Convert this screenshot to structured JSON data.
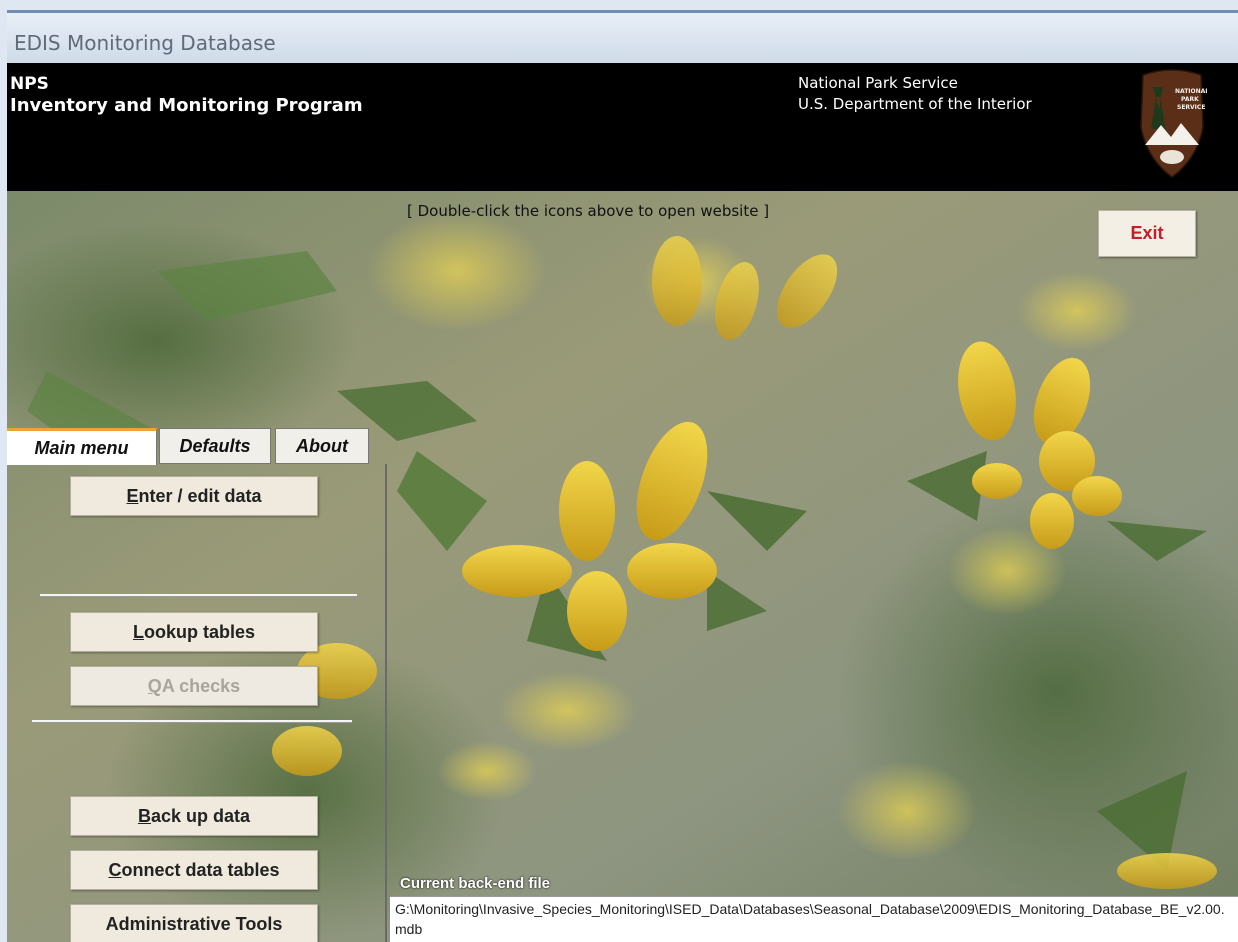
{
  "window": {
    "title": "EDIS Monitoring Database"
  },
  "header": {
    "program_short": "NPS",
    "program_name": "Inventory and Monitoring Program",
    "agency": "National Park Service",
    "department": "U.S. Department of the Interior",
    "logo_icon": "nps-arrowhead-icon"
  },
  "hint": "[ Double-click the icons above to open website ]",
  "exit_label": "Exit",
  "tabs": [
    {
      "label": "Main menu",
      "active": true
    },
    {
      "label": "Defaults",
      "active": false
    },
    {
      "label": "About",
      "active": false
    }
  ],
  "menu": {
    "enter_edit": {
      "accel": "E",
      "rest": "nter / edit data"
    },
    "lookup": {
      "accel": "L",
      "rest": "ookup tables"
    },
    "qa": {
      "accel": "Q",
      "rest": "A checks",
      "enabled": false
    },
    "backup": {
      "accel": "B",
      "rest": "ack up data"
    },
    "connect": {
      "accel": "C",
      "rest": "onnect data tables"
    },
    "admin": {
      "label": "Administrative Tools"
    }
  },
  "backend": {
    "label": "Current back-end file",
    "path": "G:\\Monitoring\\Invasive_Species_Monitoring\\ISED_Data\\Databases\\Seasonal_Database\\2009\\EDIS_Monitoring_Database_BE_v2.00.mdb"
  },
  "colors": {
    "exit_text": "#c0202a",
    "tab_accent": "#f0a23a",
    "header_bg": "#000000"
  }
}
